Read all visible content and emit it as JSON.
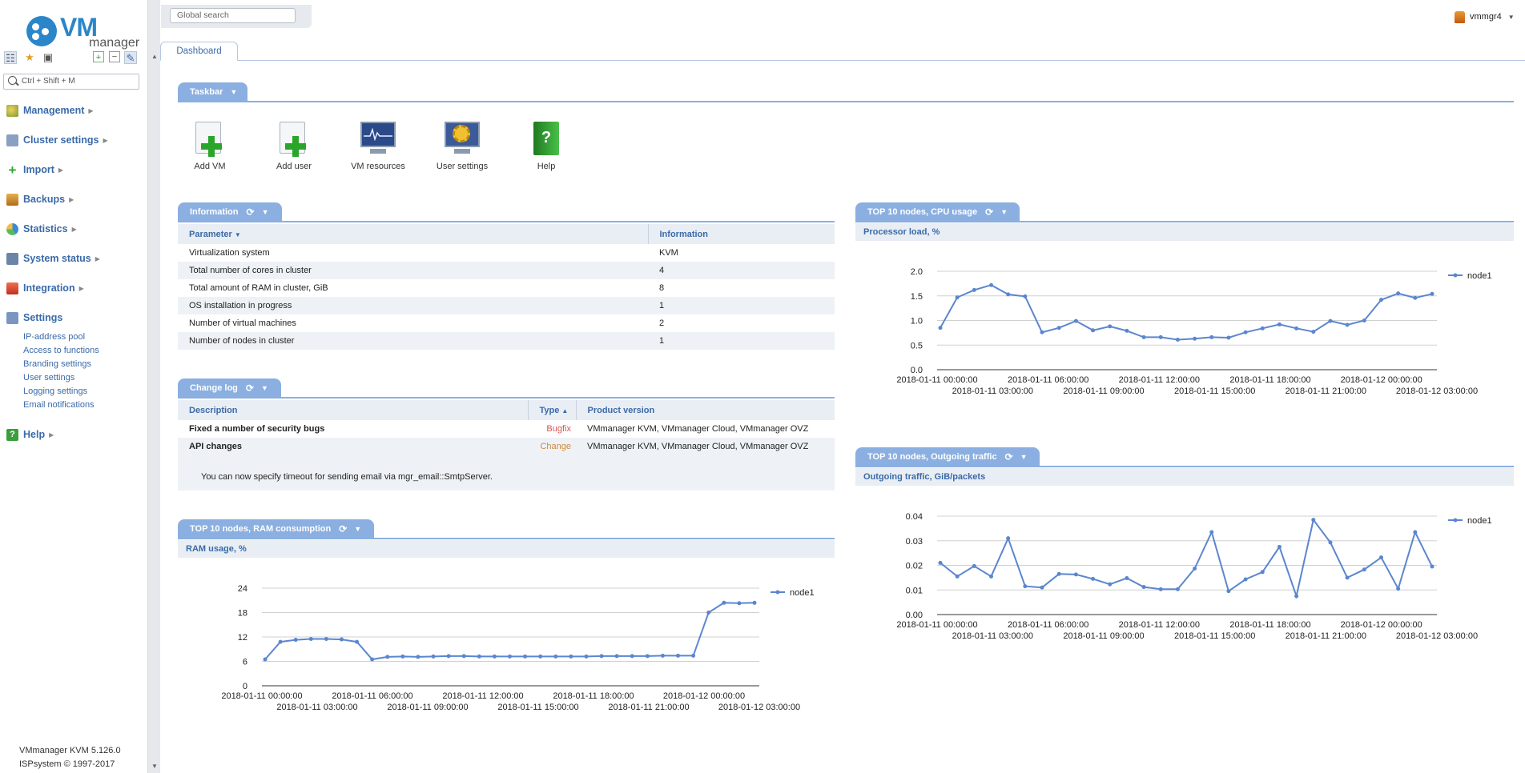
{
  "app": {
    "logo_text": "VM",
    "logo_sub": "manager"
  },
  "sidebar": {
    "quick_search_placeholder": "Ctrl + Shift + M",
    "menu": [
      {
        "label": "Management",
        "icon": "management-icon"
      },
      {
        "label": "Cluster settings",
        "icon": "cluster-settings-icon"
      },
      {
        "label": "Import",
        "icon": "import-icon"
      },
      {
        "label": "Backups",
        "icon": "backups-icon"
      },
      {
        "label": "Statistics",
        "icon": "statistics-icon"
      },
      {
        "label": "System status",
        "icon": "system-status-icon"
      },
      {
        "label": "Integration",
        "icon": "integration-icon"
      },
      {
        "label": "Settings",
        "icon": "settings-icon"
      },
      {
        "label": "Help",
        "icon": "help-icon"
      }
    ],
    "settings_sub": [
      "IP-address pool",
      "Access to functions",
      "Branding settings",
      "User settings",
      "Logging settings",
      "Email notifications"
    ],
    "version": "VMmanager KVM 5.126.0",
    "copyright": "ISPsystem © 1997-2017"
  },
  "header": {
    "global_search_placeholder": "Global search",
    "user": "vmmgr4"
  },
  "tabs": [
    {
      "label": "Dashboard"
    }
  ],
  "taskbar": {
    "title": "Taskbar",
    "items": [
      {
        "label": "Add VM"
      },
      {
        "label": "Add user"
      },
      {
        "label": "VM resources"
      },
      {
        "label": "User settings"
      },
      {
        "label": "Help"
      }
    ]
  },
  "information": {
    "title": "Information",
    "columns": [
      "Parameter",
      "Information"
    ],
    "rows": [
      [
        "Virtualization system",
        "KVM"
      ],
      [
        "Total number of cores in cluster",
        "4"
      ],
      [
        "Total amount of RAM in cluster, GiB",
        "8"
      ],
      [
        "OS installation in progress",
        "1"
      ],
      [
        "Number of virtual machines",
        "2"
      ],
      [
        "Number of nodes in cluster",
        "1"
      ]
    ]
  },
  "changelog": {
    "title": "Change log",
    "columns": [
      "Description",
      "Type",
      "Product version"
    ],
    "rows": [
      {
        "description": "Fixed a number of security bugs",
        "type": "Bugfix",
        "version": "VMmanager KVM, VMmanager Cloud, VMmanager OVZ"
      },
      {
        "description": "API changes",
        "type": "Change",
        "version": "VMmanager KVM, VMmanager Cloud, VMmanager OVZ"
      }
    ],
    "note": "You can now specify timeout for sending email via mgr_email::SmtpServer.",
    "colors": {
      "bugfix": "#d9534f",
      "change": "#d08a3a"
    }
  },
  "chart_data": [
    {
      "panel_title": "TOP 10 nodes, RAM consumption",
      "title": "RAM usage, %",
      "type": "line",
      "ylim": [
        0,
        24
      ],
      "yticks": [
        "0",
        "6",
        "12",
        "18",
        "24"
      ],
      "xticks_top": [
        "2018-01-11 00:00:00",
        "2018-01-11 06:00:00",
        "2018-01-11 12:00:00",
        "2018-01-11 18:00:00",
        "2018-01-12 00:00:00"
      ],
      "xticks_bottom": [
        "2018-01-11 03:00:00",
        "2018-01-11 09:00:00",
        "2018-01-11 15:00:00",
        "2018-01-11 21:00:00",
        "2018-01-12 03:00:00"
      ],
      "series": [
        {
          "name": "node1",
          "values": [
            6.5,
            10.8,
            11.3,
            11.5,
            11.5,
            11.4,
            10.8,
            6.5,
            7.1,
            7.2,
            7.1,
            7.2,
            7.3,
            7.3,
            7.2,
            7.2,
            7.2,
            7.2,
            7.2,
            7.2,
            7.2,
            7.2,
            7.3,
            7.3,
            7.3,
            7.3,
            7.4,
            7.4,
            7.4,
            18.0,
            20.4,
            20.3,
            20.4
          ]
        }
      ],
      "legend": "top-right",
      "color": "#5b86cf"
    },
    {
      "panel_title": "TOP 10 nodes, CPU usage",
      "title": "Processor load, %",
      "type": "line",
      "ylim": [
        0,
        2.0
      ],
      "yticks": [
        "0.0",
        "0.5",
        "1.0",
        "1.5",
        "2.0"
      ],
      "xticks_top": [
        "2018-01-11 00:00:00",
        "2018-01-11 06:00:00",
        "2018-01-11 12:00:00",
        "2018-01-11 18:00:00",
        "2018-01-12 00:00:00"
      ],
      "xticks_bottom": [
        "2018-01-11 03:00:00",
        "2018-01-11 09:00:00",
        "2018-01-11 15:00:00",
        "2018-01-11 21:00:00",
        "2018-01-12 03:00:00"
      ],
      "series": [
        {
          "name": "node1",
          "values": [
            0.85,
            1.47,
            1.62,
            1.72,
            1.53,
            1.49,
            0.76,
            0.85,
            0.99,
            0.8,
            0.88,
            0.79,
            0.66,
            0.66,
            0.61,
            0.63,
            0.66,
            0.65,
            0.76,
            0.84,
            0.92,
            0.84,
            0.77,
            0.99,
            0.91,
            1.0,
            1.42,
            1.55,
            1.46,
            1.54
          ]
        }
      ],
      "legend": "top-right",
      "color": "#5b86cf"
    },
    {
      "panel_title": "TOP 10 nodes, Outgoing traffic",
      "title": "Outgoing traffic, GiB/packets",
      "type": "line",
      "ylim": [
        0,
        0.04
      ],
      "yticks": [
        "0.00",
        "0.01",
        "0.02",
        "0.03",
        "0.04"
      ],
      "xticks_top": [
        "2018-01-11 00:00:00",
        "2018-01-11 06:00:00",
        "2018-01-11 12:00:00",
        "2018-01-11 18:00:00",
        "2018-01-12 00:00:00"
      ],
      "xticks_bottom": [
        "2018-01-11 03:00:00",
        "2018-01-11 09:00:00",
        "2018-01-11 15:00:00",
        "2018-01-11 21:00:00",
        "2018-01-12 03:00:00"
      ],
      "series": [
        {
          "name": "node1",
          "values": [
            0.021,
            0.0155,
            0.0197,
            0.0155,
            0.031,
            0.0115,
            0.011,
            0.0165,
            0.0163,
            0.0145,
            0.0123,
            0.0148,
            0.0112,
            0.0103,
            0.0103,
            0.0187,
            0.0335,
            0.0095,
            0.0143,
            0.0173,
            0.0275,
            0.0075,
            0.0385,
            0.0293,
            0.015,
            0.0183,
            0.0232,
            0.0105,
            0.0335,
            0.0195
          ]
        }
      ],
      "legend": "top-right",
      "color": "#5b86cf"
    }
  ]
}
